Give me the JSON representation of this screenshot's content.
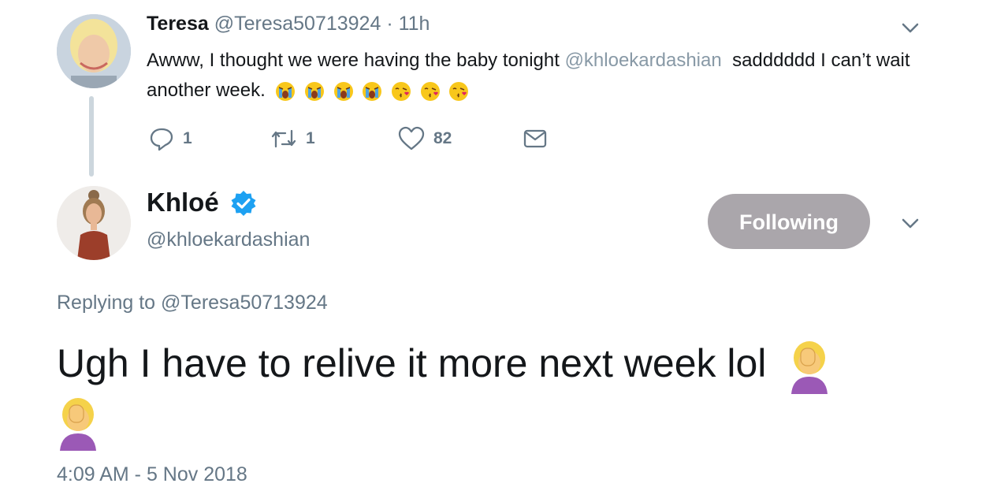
{
  "parent_tweet": {
    "display_name": "Teresa",
    "handle": "@Teresa50713924",
    "separator": "·",
    "time_ago": "11h",
    "text_part1": "Awww, I thought we were having the baby tonight",
    "mention": "@khloekardashian",
    "text_part2": "sadddddd I can’t wait another week.",
    "emojis": [
      "loudly-crying-face",
      "loudly-crying-face",
      "loudly-crying-face",
      "loudly-crying-face",
      "face-blowing-kiss",
      "face-blowing-kiss",
      "face-blowing-kiss"
    ],
    "reply_count": "1",
    "retweet_count": "1",
    "like_count": "82"
  },
  "reply_tweet": {
    "display_name": "Khloé",
    "handle": "@khloekardashian",
    "follow_label": "Following",
    "replying_prefix": "Replying to",
    "replying_to": "@Teresa50713924",
    "text": "Ugh I have to relive it more next week lol",
    "emojis": [
      "woman-facepalming",
      "woman-facepalming"
    ],
    "timestamp": "4:09 AM - 5 Nov 2018"
  },
  "colors": {
    "text": "#14171a",
    "secondary": "#657786",
    "verified": "#1da1f2",
    "following_button": "#aaa6ab",
    "thread_line": "#ccd6dd"
  }
}
